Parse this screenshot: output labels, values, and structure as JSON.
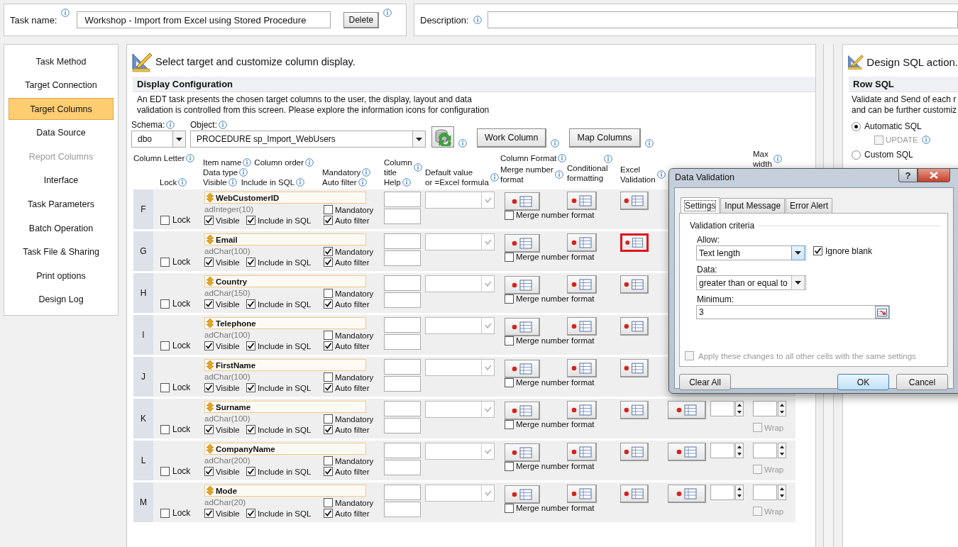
{
  "task": {
    "label": "Task name:",
    "value": "Workshop - Import from Excel using Stored Procedure",
    "delete_button": "Delete"
  },
  "description": {
    "label": "Description:"
  },
  "sidebar": {
    "items": [
      {
        "label": "Task Method",
        "selected": false,
        "disabled": false
      },
      {
        "label": "Target Connection",
        "selected": false,
        "disabled": false
      },
      {
        "label": "Target Columns",
        "selected": true,
        "disabled": false
      },
      {
        "label": "Data Source",
        "selected": false,
        "disabled": false
      },
      {
        "label": "Report Columns",
        "selected": false,
        "disabled": true
      },
      {
        "label": "Interface",
        "selected": false,
        "disabled": false
      },
      {
        "label": "Task Parameters",
        "selected": false,
        "disabled": false
      },
      {
        "label": "Batch Operation",
        "selected": false,
        "disabled": false
      },
      {
        "label": "Task File & Sharing",
        "selected": false,
        "disabled": false
      },
      {
        "label": "Print options",
        "selected": false,
        "disabled": false
      },
      {
        "label": "Design Log",
        "selected": false,
        "disabled": false
      }
    ]
  },
  "main": {
    "heading": "Select target and customize column display.",
    "section": "Display Configuration",
    "intro": "An EDT task presents the chosen target columns to the user, the display, layout and data\nvalidation is controlled from this screen.  Please explore the information icons for configuration",
    "schema": {
      "label": "Schema:",
      "value": "dbo"
    },
    "object": {
      "label": "Object:",
      "value": "PROCEDURE sp_Import_WebUsers"
    },
    "buttons": [
      "Work Column",
      "Map Columns"
    ],
    "headers": {
      "column_letter": "Column Letter",
      "lock": "Lock",
      "item_name": "Item name",
      "column_order": "Column order",
      "data_type": "Data type",
      "visible": "Visible",
      "include_in_sql": "Include in SQL",
      "mandatory": "Mandatory",
      "auto_filter": "Auto filter",
      "column_title": "Column\ntitle",
      "help": "Help",
      "default_value": "Default value\nor =Excel formula",
      "column_format": "Column Format",
      "merge_number_format": "Merge number\nformat",
      "conditional_formatting": "Conditional\nformatting",
      "excel_validation": "Excel\nValidation",
      "max_width": "Max\nwidth"
    },
    "rows": [
      {
        "letter": "F",
        "name": "WebCustomerID",
        "data_type": "adInteger(10)",
        "lock": {
          "label": "Lock",
          "checked": false
        },
        "visible": {
          "label": "Visible",
          "checked": true
        },
        "include": {
          "label": "Include in SQL",
          "checked": true
        },
        "mandatory": {
          "label": "Mandatory",
          "checked": false
        },
        "auto_filter": {
          "label": "Auto filter",
          "checked": true
        },
        "merge": {
          "label": "Merge number format",
          "checked": false
        },
        "validation_highlighted": false
      },
      {
        "letter": "G",
        "name": "Email",
        "data_type": "adChar(100)",
        "lock": {
          "label": "Lock",
          "checked": false
        },
        "visible": {
          "label": "Visible",
          "checked": true
        },
        "include": {
          "label": "Include in SQL",
          "checked": true
        },
        "mandatory": {
          "label": "Mandatory",
          "checked": true
        },
        "auto_filter": {
          "label": "Auto filter",
          "checked": true
        },
        "merge": {
          "label": "Merge number format",
          "checked": false
        },
        "validation_highlighted": true
      },
      {
        "letter": "H",
        "name": "Country",
        "data_type": "adChar(150)",
        "lock": {
          "label": "Lock",
          "checked": false
        },
        "visible": {
          "label": "Visible",
          "checked": true
        },
        "include": {
          "label": "Include in SQL",
          "checked": true
        },
        "mandatory": {
          "label": "Mandatory",
          "checked": false
        },
        "auto_filter": {
          "label": "Auto filter",
          "checked": true
        },
        "merge": {
          "label": "Merge number format",
          "checked": false
        },
        "validation_highlighted": false
      },
      {
        "letter": "I",
        "name": "Telephone",
        "data_type": "adChar(100)",
        "lock": {
          "label": "Lock",
          "checked": false
        },
        "visible": {
          "label": "Visible",
          "checked": true
        },
        "include": {
          "label": "Include in SQL",
          "checked": true
        },
        "mandatory": {
          "label": "Mandatory",
          "checked": false
        },
        "auto_filter": {
          "label": "Auto filter",
          "checked": true
        },
        "merge": {
          "label": "Merge number format",
          "checked": false
        },
        "validation_highlighted": false
      },
      {
        "letter": "J",
        "name": "FirstName",
        "data_type": "adChar(100)",
        "lock": {
          "label": "Lock",
          "checked": false
        },
        "visible": {
          "label": "Visible",
          "checked": true
        },
        "include": {
          "label": "Include in SQL",
          "checked": true
        },
        "mandatory": {
          "label": "Mandatory",
          "checked": false
        },
        "auto_filter": {
          "label": "Auto filter",
          "checked": true
        },
        "merge": {
          "label": "Merge number format",
          "checked": false
        },
        "validation_highlighted": false
      },
      {
        "letter": "K",
        "name": "Surname",
        "data_type": "adChar(100)",
        "lock": {
          "label": "Lock",
          "checked": false
        },
        "visible": {
          "label": "Visible",
          "checked": true
        },
        "include": {
          "label": "Include in SQL",
          "checked": true
        },
        "mandatory": {
          "label": "Mandatory",
          "checked": false
        },
        "auto_filter": {
          "label": "Auto filter",
          "checked": true
        },
        "merge": {
          "label": "Merge number format",
          "checked": false
        },
        "validation_highlighted": false,
        "wrap": {
          "label": "Wrap",
          "checked": false,
          "disabled": true
        }
      },
      {
        "letter": "L",
        "name": "CompanyName",
        "data_type": "adChar(200)",
        "lock": {
          "label": "Lock",
          "checked": false
        },
        "visible": {
          "label": "Visible",
          "checked": true
        },
        "include": {
          "label": "Include in SQL",
          "checked": true
        },
        "mandatory": {
          "label": "Mandatory",
          "checked": false
        },
        "auto_filter": {
          "label": "Auto filter",
          "checked": true
        },
        "merge": {
          "label": "Merge number format",
          "checked": false
        },
        "validation_highlighted": false,
        "wrap": {
          "label": "Wrap",
          "checked": false,
          "disabled": true
        }
      },
      {
        "letter": "M",
        "name": "Mode",
        "data_type": "adChar(20)",
        "lock": {
          "label": "Lock",
          "checked": false
        },
        "visible": {
          "label": "Visible",
          "checked": true
        },
        "include": {
          "label": "Include in SQL",
          "checked": true
        },
        "mandatory": {
          "label": "Mandatory",
          "checked": false
        },
        "auto_filter": {
          "label": "Auto filter",
          "checked": true
        },
        "merge": {
          "label": "Merge number format",
          "checked": false
        },
        "validation_highlighted": false,
        "wrap": {
          "label": "Wrap",
          "checked": false,
          "disabled": true
        }
      }
    ]
  },
  "sql_panel": {
    "heading": "Design SQL action.",
    "section": "Row SQL",
    "text": "Validate and Send of each r\nand can be further customiz",
    "options": [
      {
        "label": "Automatic SQL",
        "selected": true
      },
      {
        "label": "Custom SQL",
        "selected": false
      }
    ],
    "update": {
      "label": "UPDATE",
      "checked": false,
      "disabled": true
    }
  },
  "dialog": {
    "title": "Data Validation",
    "help_button": "?",
    "tabs": [
      {
        "label": "Settings",
        "selected": true
      },
      {
        "label": "Input Message",
        "selected": false
      },
      {
        "label": "Error Alert",
        "selected": false
      }
    ],
    "group": "Validation criteria",
    "allow": {
      "label": "Allow:",
      "value": "Text length"
    },
    "ignore_blank": {
      "label": "Ignore blank",
      "checked": true
    },
    "data": {
      "label": "Data:",
      "value": "greater than or equal to"
    },
    "minimum": {
      "label": "Minimum:",
      "value": "3"
    },
    "apply_all": {
      "label": "Apply these changes to all other cells with the same settings",
      "checked": false,
      "disabled": true
    },
    "buttons": [
      {
        "label": "Clear All",
        "default": false
      },
      {
        "label": "OK",
        "default": true
      },
      {
        "label": "Cancel",
        "default": false
      }
    ]
  }
}
